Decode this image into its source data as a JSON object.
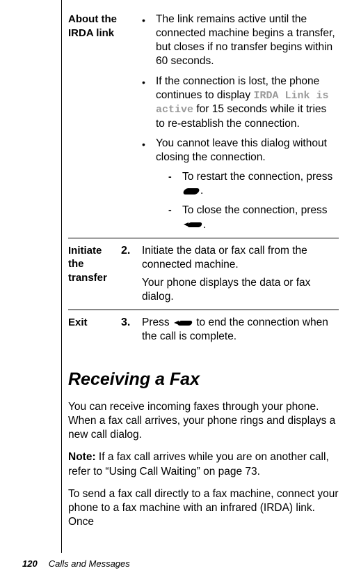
{
  "table": {
    "rows": [
      {
        "label": "About the IRDA link",
        "num": "",
        "bullets": [
          {
            "mark": "•",
            "text": "The link remains active until the connected machine begins a transfer, but closes if no transfer begins within 60 seconds."
          },
          {
            "mark": "•",
            "text_pre": "If the connection is lost, the phone continues to display ",
            "mono": "IRDA Link is active",
            "text_post": " for 15 seconds while it tries to re-establish the connection."
          },
          {
            "mark": "•",
            "text": "You cannot leave this dialog without closing the connection.",
            "sub": [
              {
                "mark": "-",
                "text_pre": "To restart the connection, press ",
                "key": "ok",
                "text_post": "."
              },
              {
                "mark": "-",
                "text_pre": "To close the connection, press ",
                "key": "end",
                "text_post": "."
              }
            ]
          }
        ]
      },
      {
        "label": "Initiate the transfer",
        "num": "2.",
        "para1": "Initiate the data or fax call from the connected machine.",
        "para2": "Your phone displays the data or fax dialog."
      },
      {
        "label": "Exit",
        "num": "3.",
        "exit_pre": "Press ",
        "exit_post": " to end the connection when the call is complete."
      }
    ]
  },
  "section_heading": "Receiving a Fax",
  "body": {
    "p1": "You can receive incoming faxes through your phone. When a fax call arrives, your phone rings and displays a new call dialog.",
    "p2_label": "Note:",
    "p2_text": " If a fax call arrives while you are on another call, refer to “Using Call Waiting” on page 73.",
    "p3": "To send a fax call directly to a fax machine, connect your phone to a fax machine with an infrared (IRDA) link. Once"
  },
  "footer": {
    "page": "120",
    "title": "Calls and Messages"
  }
}
